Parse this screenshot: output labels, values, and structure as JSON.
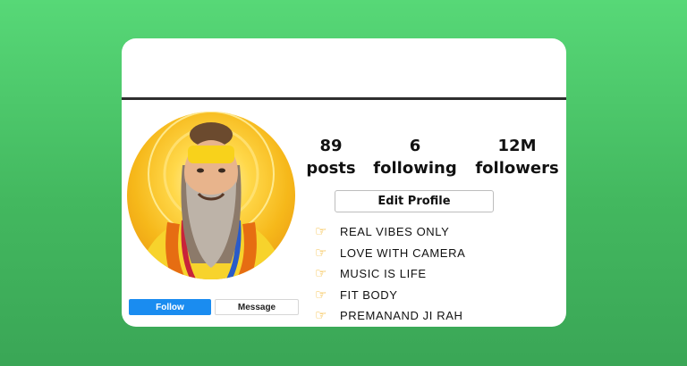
{
  "profile": {
    "stats": [
      {
        "num": "89",
        "label": "posts"
      },
      {
        "num": "6",
        "label": "following"
      },
      {
        "num": "12M",
        "label": "followers"
      }
    ],
    "edit_label": "Edit Profile",
    "follow_label": "Follow",
    "message_label": "Message",
    "bio": [
      {
        "icon": "pointing-hand-icon",
        "text": "REAL VIBES ONLY"
      },
      {
        "icon": "pointing-hand-icon",
        "text": "LOVE WITH CAMERA"
      },
      {
        "icon": "pointing-hand-icon",
        "text": "MUSIC IS LIFE"
      },
      {
        "icon": "pointing-hand-icon",
        "text": "FIT BODY"
      },
      {
        "icon": "pointing-hand-icon",
        "text": "PREMANAND JI RAH"
      }
    ]
  },
  "colors": {
    "background": "#4fcf6f",
    "follow_button": "#1a8cf0",
    "icon": "#f3b01b"
  }
}
